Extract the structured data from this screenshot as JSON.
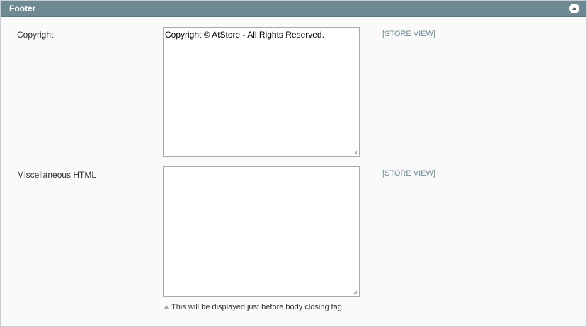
{
  "section": {
    "title": "Footer"
  },
  "fields": [
    {
      "label": "Copyright",
      "value": "Copyright © AtStore - All Rights Reserved.",
      "scope": "[STORE VIEW]"
    },
    {
      "label": "Miscellaneous HTML",
      "value": "",
      "scope": "[STORE VIEW]",
      "note": "This will be displayed just before body closing tag."
    }
  ],
  "colors": {
    "header_bg": "#6f8992",
    "panel_bg": "#fafafa",
    "scope_text": "#6f8992"
  },
  "icons": {
    "collapse": "collapse-up-icon",
    "note": "note-triangle-icon"
  }
}
